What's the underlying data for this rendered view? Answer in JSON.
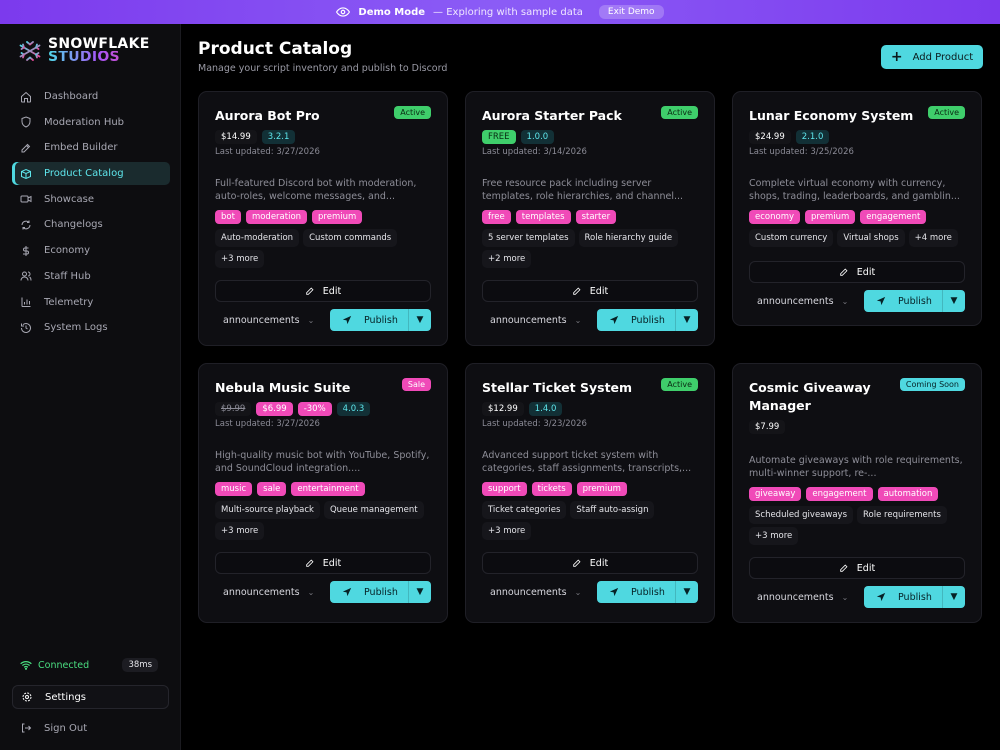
{
  "banner": {
    "mode": "Demo Mode",
    "subtitle": "— Exploring with sample data",
    "exit_label": "Exit Demo"
  },
  "brand": {
    "line1": "SNOWFLAKE",
    "line2": "STUDIOS"
  },
  "sidebar": {
    "items": [
      {
        "label": "Dashboard",
        "icon": "home-icon"
      },
      {
        "label": "Moderation Hub",
        "icon": "shield-icon"
      },
      {
        "label": "Embed Builder",
        "icon": "pencil-icon"
      },
      {
        "label": "Product Catalog",
        "icon": "package-icon",
        "active": true
      },
      {
        "label": "Showcase",
        "icon": "camera-icon"
      },
      {
        "label": "Changelogs",
        "icon": "refresh-icon"
      },
      {
        "label": "Economy",
        "icon": "dollar-icon"
      },
      {
        "label": "Staff Hub",
        "icon": "users-icon"
      },
      {
        "label": "Telemetry",
        "icon": "bar-chart-icon"
      },
      {
        "label": "System Logs",
        "icon": "history-icon"
      }
    ],
    "status_label": "Connected",
    "latency": "38ms",
    "settings_label": "Settings",
    "signout_label": "Sign Out"
  },
  "header": {
    "title": "Product Catalog",
    "subtitle": "Manage your script inventory and publish to Discord",
    "add_label": "Add Product"
  },
  "common": {
    "edit_label": "Edit",
    "publish_label": "Publish",
    "channel": "announcements"
  },
  "products": [
    {
      "title": "Aurora Bot Pro",
      "badge": "Active",
      "price": "$14.99",
      "version": "3.2.1",
      "updated": "Last updated: 3/27/2026",
      "description": "Full-featured Discord bot with moderation, auto-roles, welcome messages, and...",
      "tags": [
        "bot",
        "moderation",
        "premium"
      ],
      "features": [
        "Auto-moderation",
        "Custom commands",
        "+3 more"
      ]
    },
    {
      "title": "Aurora Starter Pack",
      "badge": "Active",
      "price": "FREE",
      "version": "1.0.0",
      "updated": "Last updated: 3/14/2026",
      "description": "Free resource pack including server templates, role hierarchies, and channel...",
      "tags": [
        "free",
        "templates",
        "starter"
      ],
      "features": [
        "5 server templates",
        "Role hierarchy guide",
        "+2 more"
      ]
    },
    {
      "title": "Lunar Economy System",
      "badge": "Active",
      "price": "$24.99",
      "version": "2.1.0",
      "updated": "Last updated: 3/25/2026",
      "description": "Complete virtual economy with currency, shops, trading, leaderboards, and gamblin...",
      "tags": [
        "economy",
        "premium",
        "engagement"
      ],
      "features": [
        "Custom currency",
        "Virtual shops",
        "+4 more"
      ]
    },
    {
      "title": "Nebula Music Suite",
      "badge": "Sale",
      "original_price": "$9.99",
      "price": "$6.99",
      "discount": "-30%",
      "version": "4.0.3",
      "updated": "Last updated: 3/27/2026",
      "description": "High-quality music bot with YouTube, Spotify, and SoundCloud integration....",
      "tags": [
        "music",
        "sale",
        "entertainment"
      ],
      "features": [
        "Multi-source playback",
        "Queue management",
        "+3 more"
      ]
    },
    {
      "title": "Stellar Ticket System",
      "badge": "Active",
      "price": "$12.99",
      "version": "1.4.0",
      "updated": "Last updated: 3/23/2026",
      "description": "Advanced support ticket system with categories, staff assignments, transcripts,...",
      "tags": [
        "support",
        "tickets",
        "premium"
      ],
      "features": [
        "Ticket categories",
        "Staff auto-assign",
        "+3 more"
      ]
    },
    {
      "title": "Cosmic Giveaway Manager",
      "badge": "Coming Soon",
      "price": "$7.99",
      "description": "Automate giveaways with role requirements, multi-winner support, re-...",
      "tags": [
        "giveaway",
        "engagement",
        "automation"
      ],
      "features": [
        "Scheduled giveaways",
        "Role requirements",
        "+3 more"
      ]
    }
  ],
  "colors": {
    "accent": "#4fd8e0",
    "tag_pink": "#f04ab8",
    "active_green": "#3fce6b",
    "banner_purple": "#7c3aed"
  }
}
